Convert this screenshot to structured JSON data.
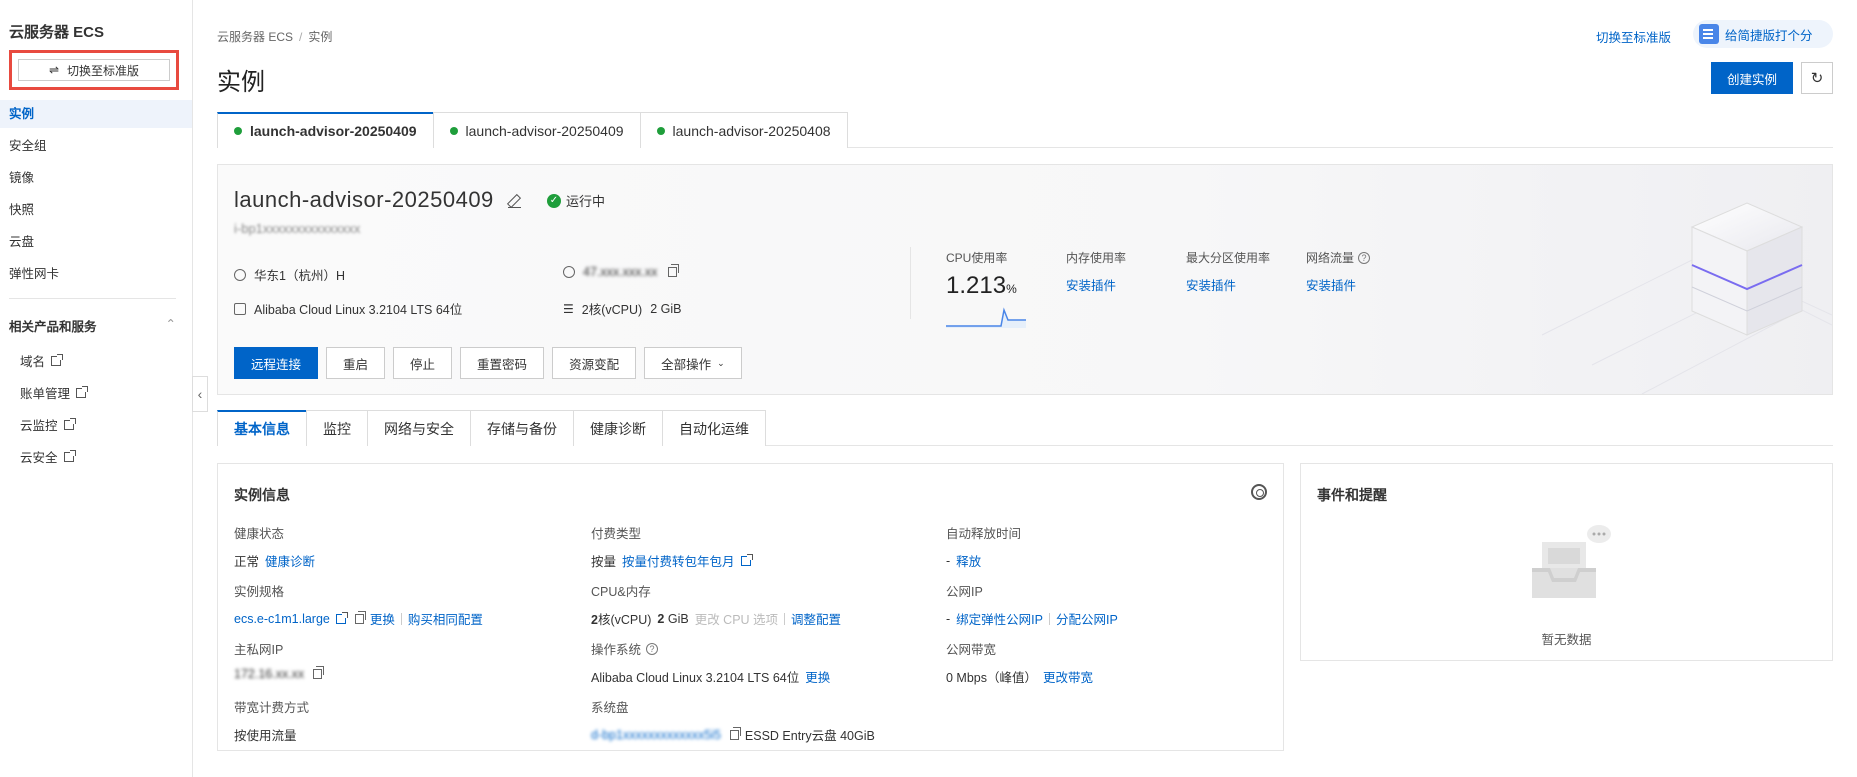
{
  "sidebar": {
    "title": "云服务器 ECS",
    "switch_label": "切换至标准版",
    "items": [
      {
        "label": "实例",
        "active": true
      },
      {
        "label": "安全组"
      },
      {
        "label": "镜像"
      },
      {
        "label": "快照"
      },
      {
        "label": "云盘"
      },
      {
        "label": "弹性网卡"
      }
    ],
    "group_label": "相关产品和服务",
    "group_items": [
      {
        "label": "域名"
      },
      {
        "label": "账单管理"
      },
      {
        "label": "云监控"
      },
      {
        "label": "云安全"
      }
    ]
  },
  "header": {
    "breadcrumb": [
      "云服务器 ECS",
      "实例"
    ],
    "title": "实例",
    "switch_link": "切换至标准版",
    "feedback": "给简捷版打个分",
    "create_button": "创建实例"
  },
  "instance_tabs": [
    {
      "label": "launch-advisor-20250409",
      "active": true
    },
    {
      "label": "launch-advisor-20250409"
    },
    {
      "label": "launch-advisor-20250408"
    }
  ],
  "instance": {
    "name": "launch-advisor-20250409",
    "status": "运行中",
    "id": "i-bp1xxxxxxxxxxxxxxx",
    "region": "华东1（杭州）H",
    "ip": "47.xxx.xxx.xx",
    "os": "Alibaba Cloud Linux 3.2104 LTS 64位",
    "spec_strong": "2核(vCPU)",
    "spec_mem": "2 GiB",
    "actions": [
      "远程连接",
      "重启",
      "停止",
      "重置密码",
      "资源变配",
      "全部操作"
    ],
    "metrics": {
      "cpu_label": "CPU使用率",
      "cpu_value": "1.213",
      "cpu_unit": "%",
      "mem_label": "内存使用率",
      "disk_label": "最大分区使用率",
      "net_label": "网络流量",
      "install_link": "安装插件"
    }
  },
  "detail_tabs": [
    "基本信息",
    "监控",
    "网络与安全",
    "存储与备份",
    "健康诊断",
    "自动化运维"
  ],
  "info_card": {
    "title": "实例信息",
    "health_label": "健康状态",
    "health_value": "正常",
    "health_link": "健康诊断",
    "billing_label": "付费类型",
    "billing_value": "按量",
    "billing_link": "按量付费转包年包月",
    "release_label": "自动释放时间",
    "release_value": "-",
    "release_link": "释放",
    "spec_label": "实例规格",
    "spec_value": "ecs.e-c1m1.large",
    "spec_change": "更换",
    "spec_buy": "购买相同配置",
    "cpu_label": "CPU&内存",
    "cpu_strong": "2",
    "cpu_rest": "核(vCPU)",
    "mem_strong": "2",
    "mem_rest": "GiB",
    "cpu_disabled": "更改 CPU 选项",
    "cpu_link": "调整配置",
    "pubip_label": "公网IP",
    "pubip_value": "-",
    "pubip_link1": "绑定弹性公网IP",
    "pubip_link2": "分配公网IP",
    "privip_label": "主私网IP",
    "privip_value": "172.16.xx.xx",
    "os_label": "操作系统",
    "os_value": "Alibaba Cloud Linux 3.2104 LTS 64位",
    "os_link": "更换",
    "bw_label": "公网带宽",
    "bw_value": "0 Mbps（峰值）",
    "bw_link": "更改带宽",
    "bwbill_label": "带宽计费方式",
    "bwbill_value": "按使用流量",
    "disk_label": "系统盘",
    "disk_id": "d-bp1xxxxxxxxxxxxx5i5",
    "disk_value": "ESSD Entry云盘  40GiB"
  },
  "event_card": {
    "title": "事件和提醒",
    "empty": "暂无数据"
  }
}
